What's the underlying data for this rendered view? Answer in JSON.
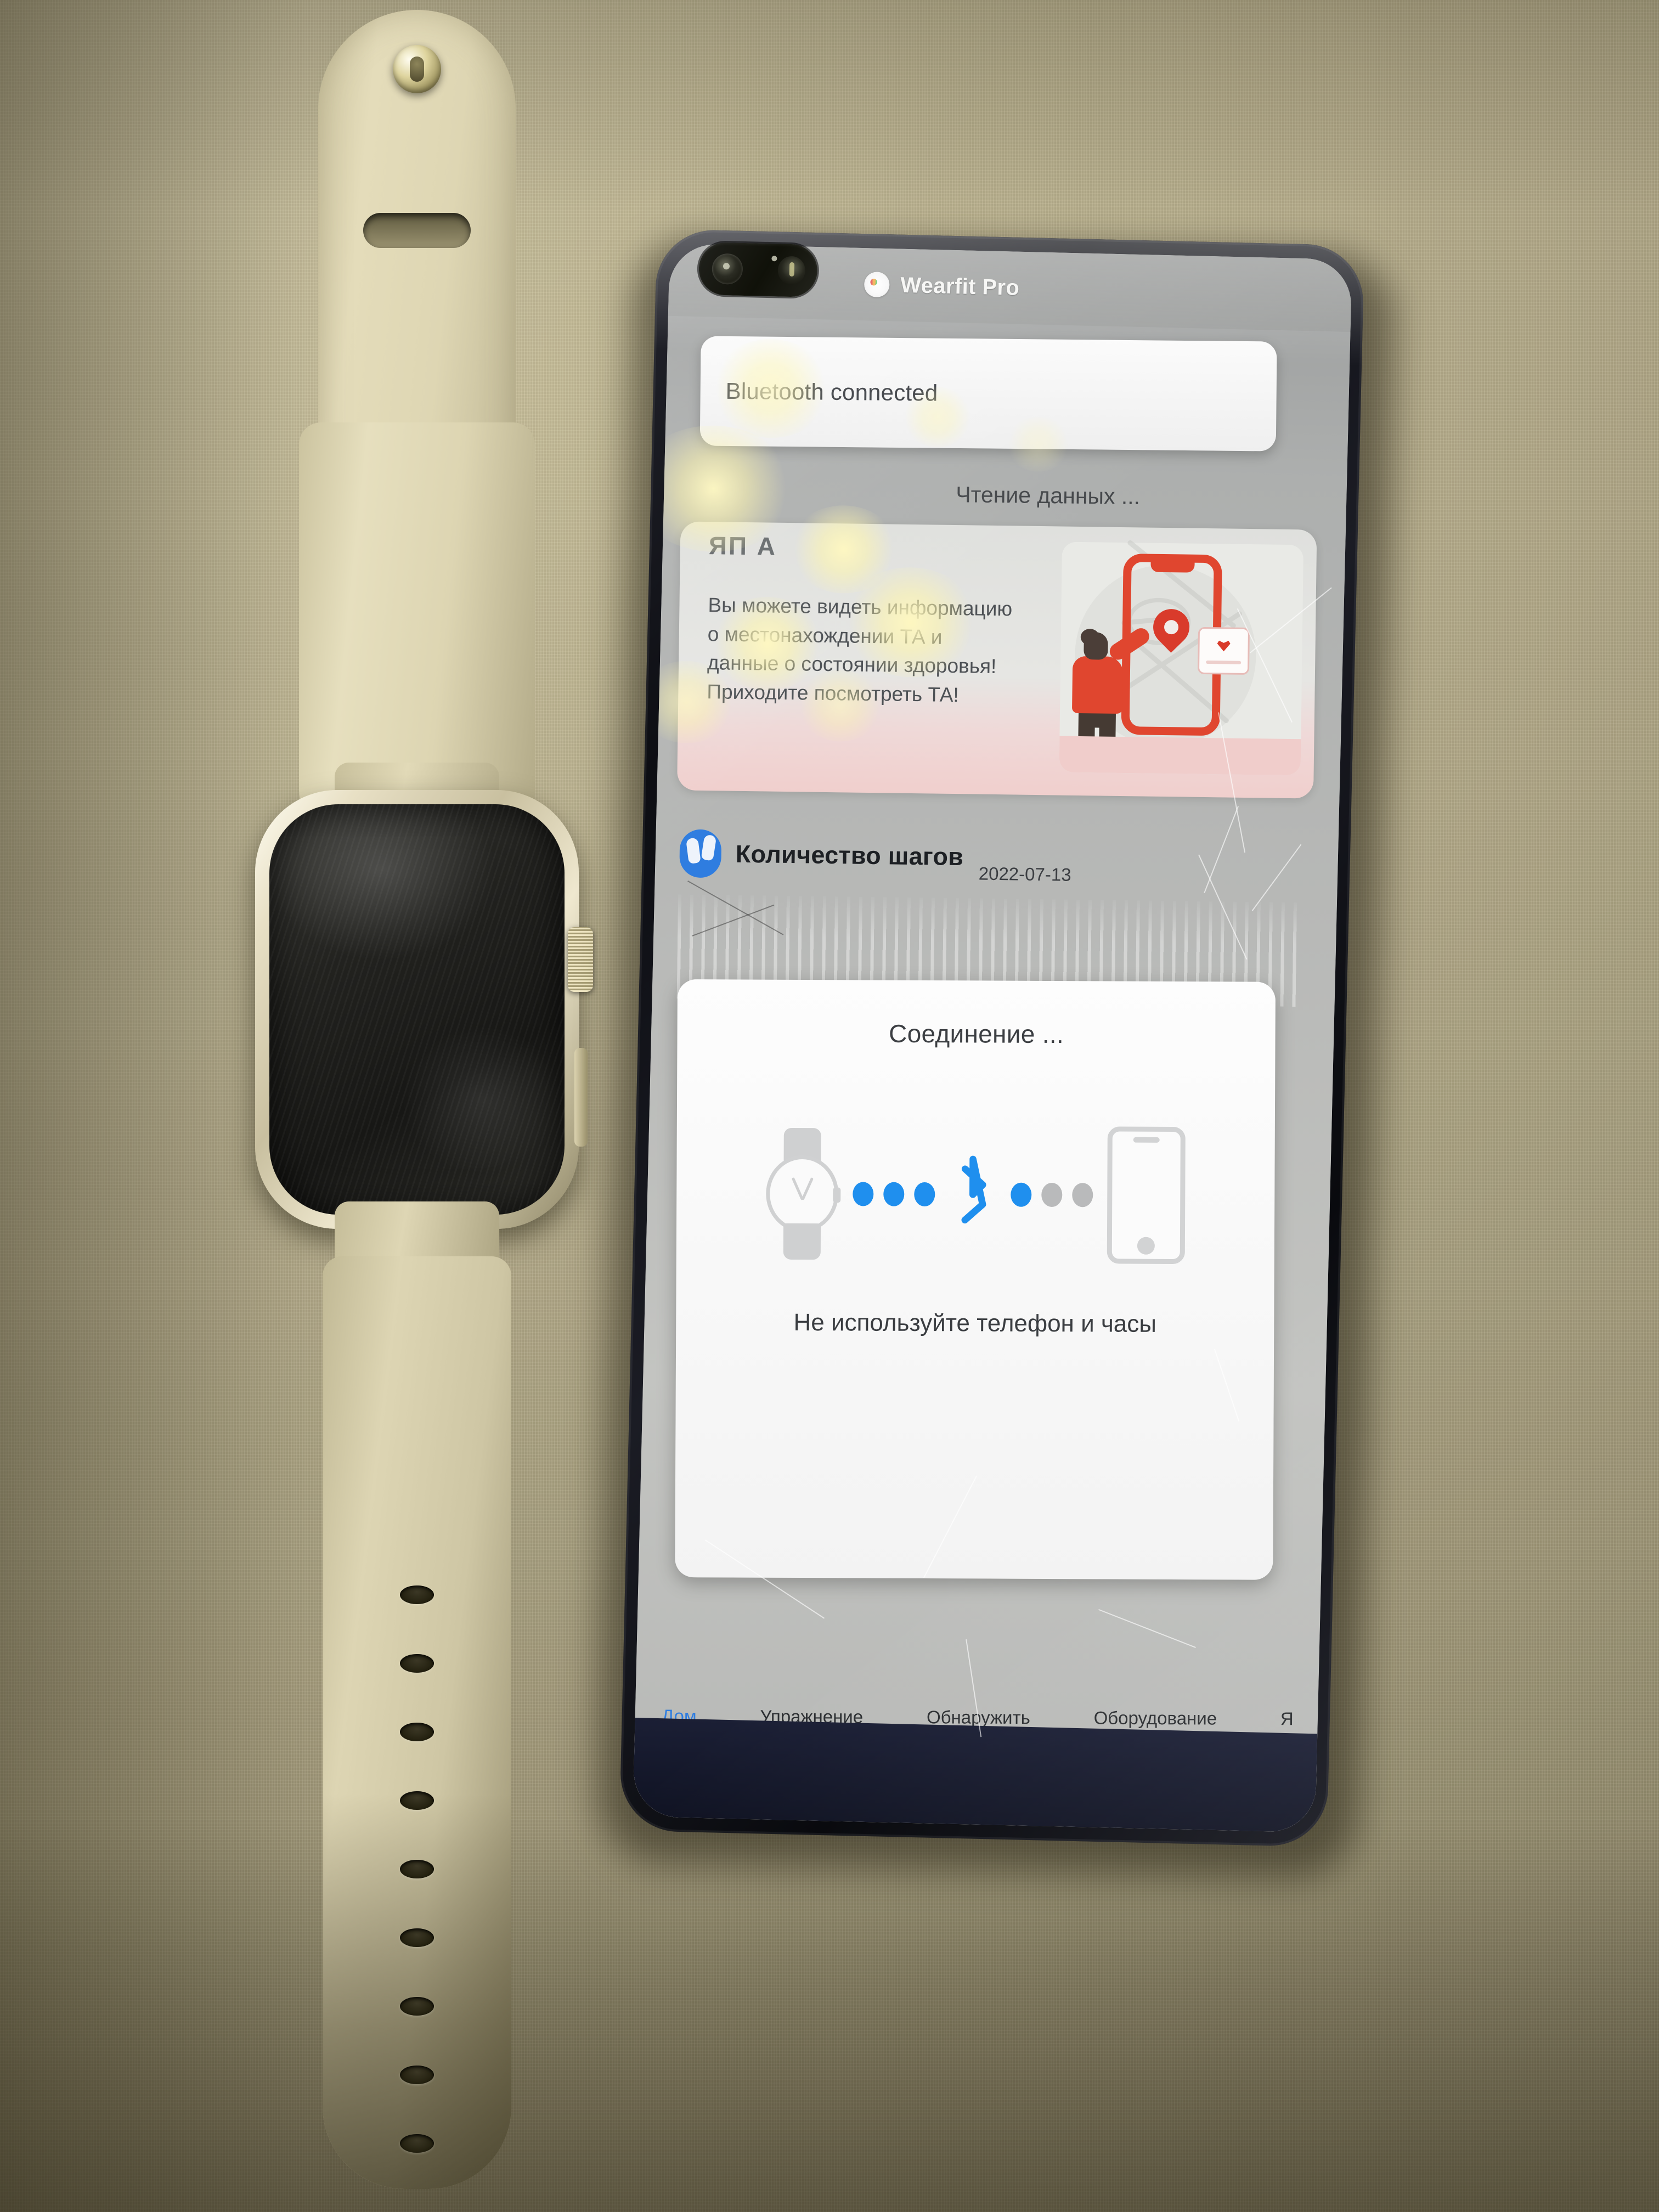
{
  "app": {
    "name": "Wearfit Pro",
    "icon": "wearfit-app-icon"
  },
  "toast": {
    "message": "Bluetooth connected"
  },
  "status": {
    "reading": "Чтение данных ..."
  },
  "promo": {
    "heading": "ЯП А",
    "body": "Вы можете видеть информацию о местонахождении ТА и данные о состоянии здоровья! Приходите посмотреть ТА!",
    "illustration": "person-pointing-at-map-phone"
  },
  "steps_card": {
    "icon": "footprints-icon",
    "title": "Количество шагов",
    "date": "2022-07-13"
  },
  "dialog": {
    "title": "Соединение ...",
    "note": "Не используйте телефон и часы",
    "watch_icon": "watch-icon",
    "bluetooth_icon": "bluetooth-icon",
    "phone_icon": "phone-icon",
    "dots_left": [
      "on",
      "on",
      "on"
    ],
    "dots_right": [
      "on",
      "off",
      "off"
    ]
  },
  "tabbar": {
    "items": [
      {
        "label": "Дом",
        "active": true
      },
      {
        "label": "Упражнение",
        "active": false
      },
      {
        "label": "Обнаружить",
        "active": false
      },
      {
        "label": "Оборудование",
        "active": false
      },
      {
        "label": "Я",
        "active": false
      }
    ]
  },
  "navbar": {
    "recent": "recents-icon",
    "home": "home-icon",
    "back": "back-icon"
  },
  "colors": {
    "accent_blue": "#1f8fee",
    "tab_active": "#2f7de0",
    "promo_red": "#e0462f",
    "steps_blue": "#2f7de0",
    "phone_frame": "#0d0e13",
    "backdrop": "#a9a183"
  },
  "devices": {
    "watch": {
      "name": "smartwatch",
      "screen_state": "off",
      "band_color": "#ded6b3",
      "band_holes": 9,
      "crown": "digital-crown",
      "side_button": "side-button"
    },
    "phone": {
      "name": "android-phone",
      "camera": "dual-punch-hole-camera",
      "screen_damage": "cracked-right-edge"
    }
  }
}
